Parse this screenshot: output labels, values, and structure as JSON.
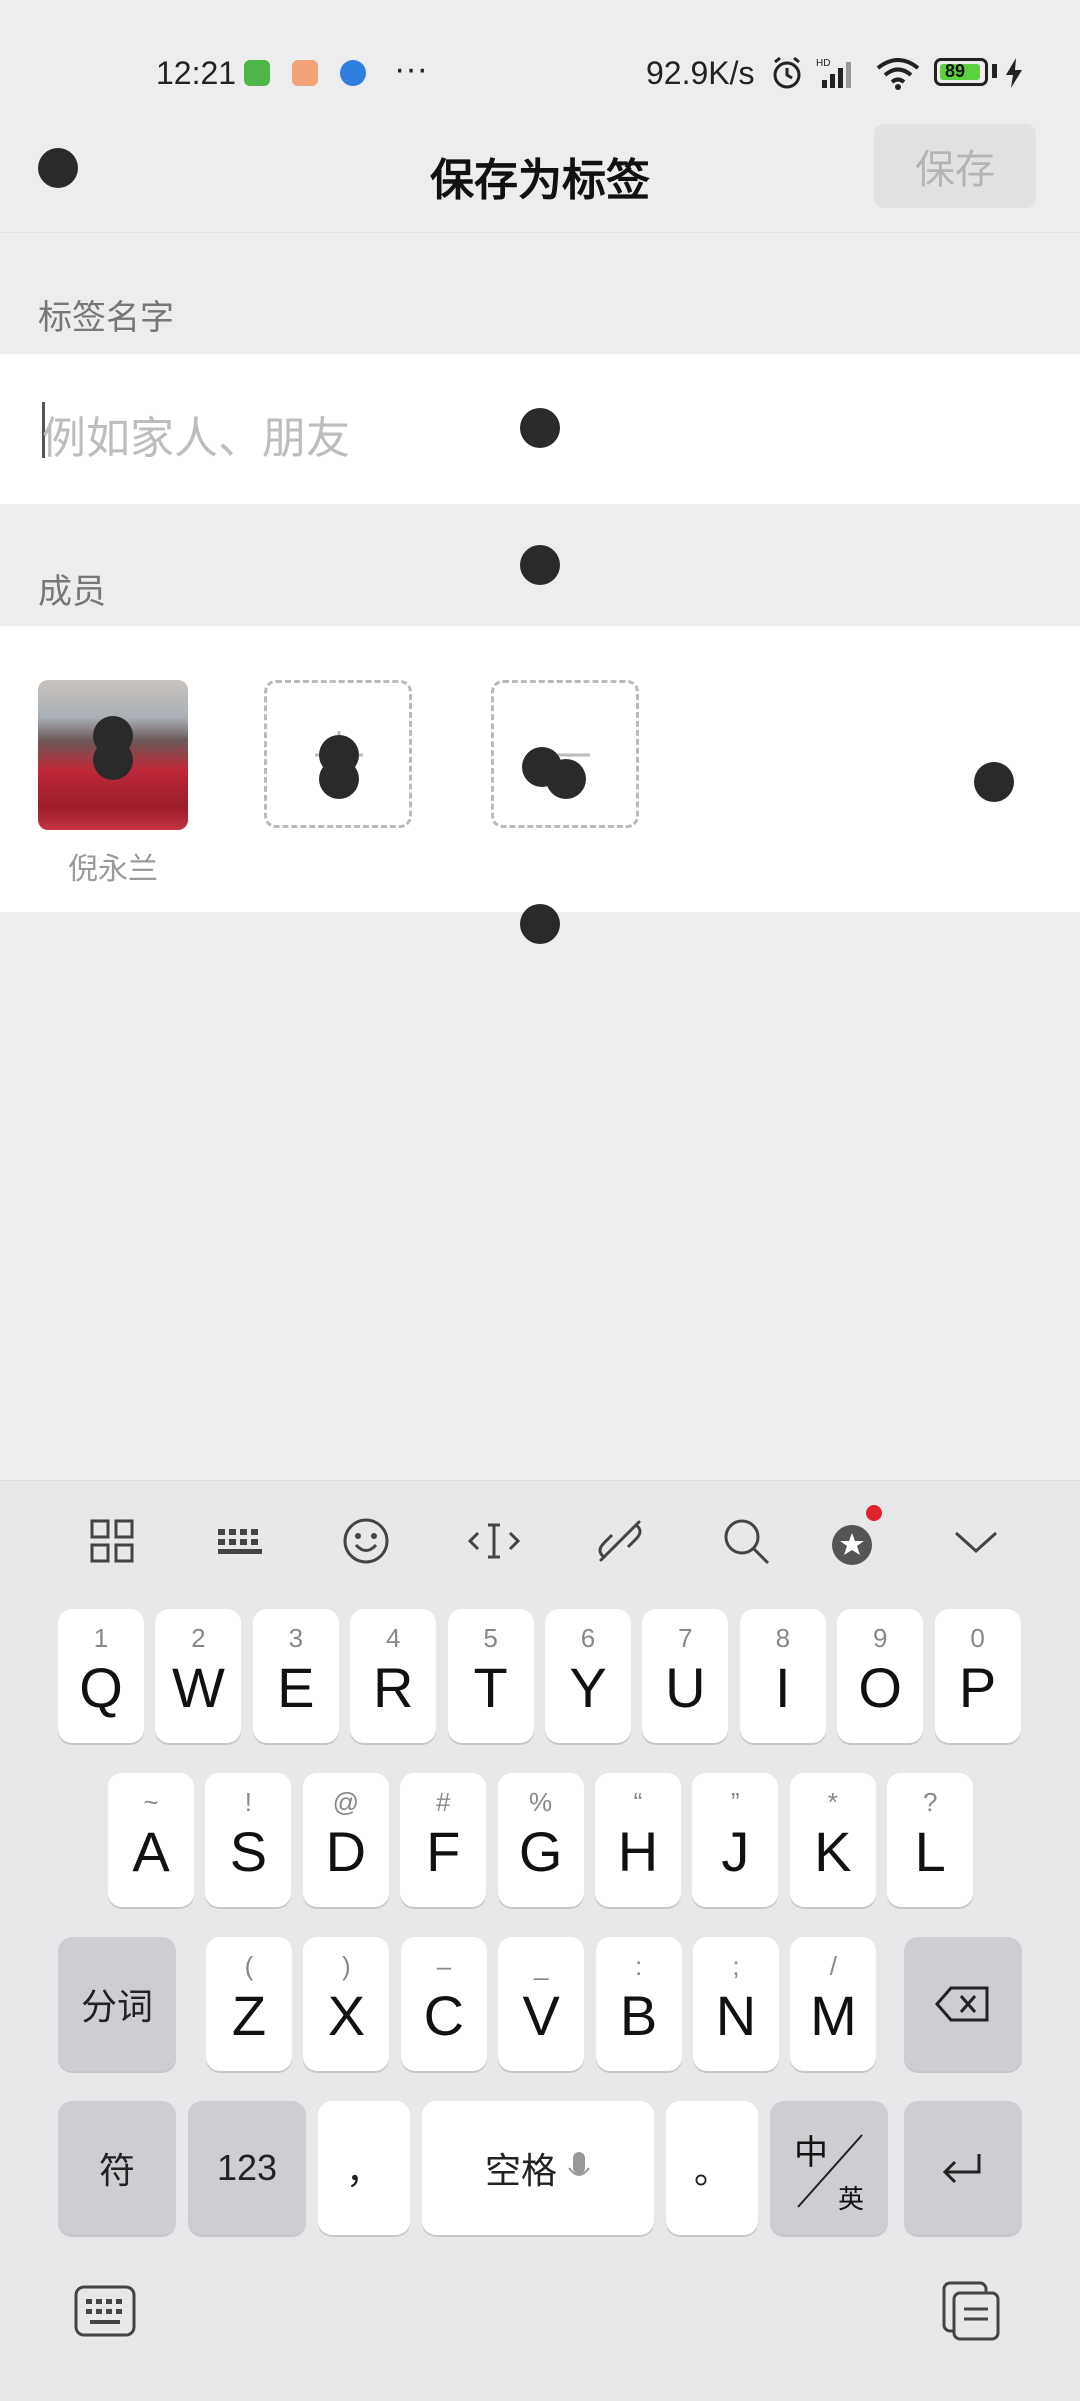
{
  "status_bar": {
    "time": "12:21",
    "more": "···",
    "speed": "92.9K/s",
    "battery": "89"
  },
  "header": {
    "title": "保存为标签",
    "save_label": "保存"
  },
  "tag_name": {
    "label": "标签名字",
    "placeholder": "例如家人、朋友",
    "value": ""
  },
  "members": {
    "label": "成员",
    "items": [
      {
        "name": "倪永兰"
      }
    ]
  },
  "keyboard": {
    "toolbar": [
      "grid-icon",
      "keyboard-layout-icon",
      "emoji-icon",
      "cursor-icon",
      "link-icon",
      "search-icon",
      "badge-icon",
      "collapse-icon"
    ],
    "row1": [
      {
        "main": "Q",
        "sub": "1"
      },
      {
        "main": "W",
        "sub": "2"
      },
      {
        "main": "E",
        "sub": "3"
      },
      {
        "main": "R",
        "sub": "4"
      },
      {
        "main": "T",
        "sub": "5"
      },
      {
        "main": "Y",
        "sub": "6"
      },
      {
        "main": "U",
        "sub": "7"
      },
      {
        "main": "I",
        "sub": "8"
      },
      {
        "main": "O",
        "sub": "9"
      },
      {
        "main": "P",
        "sub": "0"
      }
    ],
    "row2": [
      {
        "main": "A",
        "sub": "~"
      },
      {
        "main": "S",
        "sub": "!"
      },
      {
        "main": "D",
        "sub": "@"
      },
      {
        "main": "F",
        "sub": "#"
      },
      {
        "main": "G",
        "sub": "%"
      },
      {
        "main": "H",
        "sub": "“"
      },
      {
        "main": "J",
        "sub": "”"
      },
      {
        "main": "K",
        "sub": "*"
      },
      {
        "main": "L",
        "sub": "?"
      }
    ],
    "row3": [
      {
        "main": "Z",
        "sub": "("
      },
      {
        "main": "X",
        "sub": ")"
      },
      {
        "main": "C",
        "sub": "–"
      },
      {
        "main": "V",
        "sub": "_"
      },
      {
        "main": "B",
        "sub": ":"
      },
      {
        "main": "N",
        "sub": ";"
      },
      {
        "main": "M",
        "sub": "/"
      }
    ],
    "segment_label": "分词",
    "symbol_label": "符",
    "num_label": "123",
    "comma": "，",
    "space_label": "空格",
    "period": "。",
    "lang_cn": "中",
    "lang_en": "英"
  }
}
